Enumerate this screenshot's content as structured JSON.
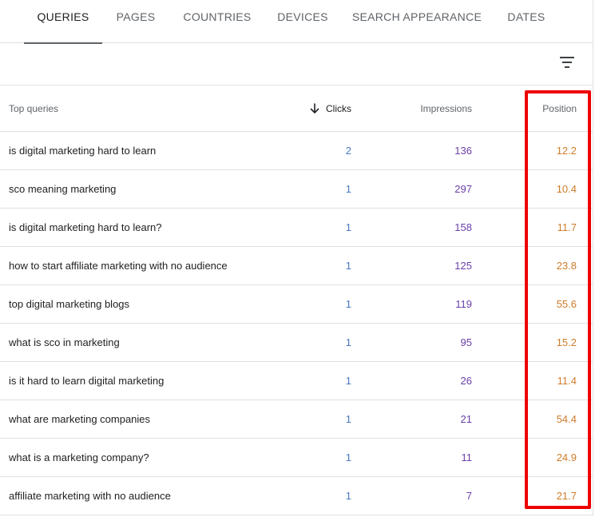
{
  "tabs": [
    {
      "label": "QUERIES",
      "active": true
    },
    {
      "label": "PAGES",
      "active": false
    },
    {
      "label": "COUNTRIES",
      "active": false
    },
    {
      "label": "DEVICES",
      "active": false
    },
    {
      "label": "SEARCH APPEARANCE",
      "active": false
    },
    {
      "label": "DATES",
      "active": false
    }
  ],
  "filter": {
    "icon": "filter-icon"
  },
  "table": {
    "headers": {
      "query": "Top queries",
      "clicks": "Clicks",
      "impressions": "Impressions",
      "position": "Position"
    },
    "sort": {
      "column": "clicks",
      "direction": "descending",
      "icon": "arrow-down-icon"
    },
    "rows": [
      {
        "query": "is digital marketing hard to learn",
        "clicks": "2",
        "impressions": "136",
        "position": "12.2"
      },
      {
        "query": "sco meaning marketing",
        "clicks": "1",
        "impressions": "297",
        "position": "10.4"
      },
      {
        "query": "is digital marketing hard to learn?",
        "clicks": "1",
        "impressions": "158",
        "position": "11.7"
      },
      {
        "query": "how to start affiliate marketing with no audience",
        "clicks": "1",
        "impressions": "125",
        "position": "23.8"
      },
      {
        "query": "top digital marketing blogs",
        "clicks": "1",
        "impressions": "119",
        "position": "55.6"
      },
      {
        "query": "what is sco in marketing",
        "clicks": "1",
        "impressions": "95",
        "position": "15.2"
      },
      {
        "query": "is it hard to learn digital marketing",
        "clicks": "1",
        "impressions": "26",
        "position": "11.4"
      },
      {
        "query": "what are marketing companies",
        "clicks": "1",
        "impressions": "21",
        "position": "54.4"
      },
      {
        "query": "what is a marketing company?",
        "clicks": "1",
        "impressions": "11",
        "position": "24.9"
      },
      {
        "query": "affiliate marketing with no audience",
        "clicks": "1",
        "impressions": "7",
        "position": "21.7"
      }
    ]
  },
  "colors": {
    "clicks": "#4a79c0",
    "impressions": "#6a3fa8",
    "position": "#d07b2a",
    "highlight": "#ee0000"
  }
}
